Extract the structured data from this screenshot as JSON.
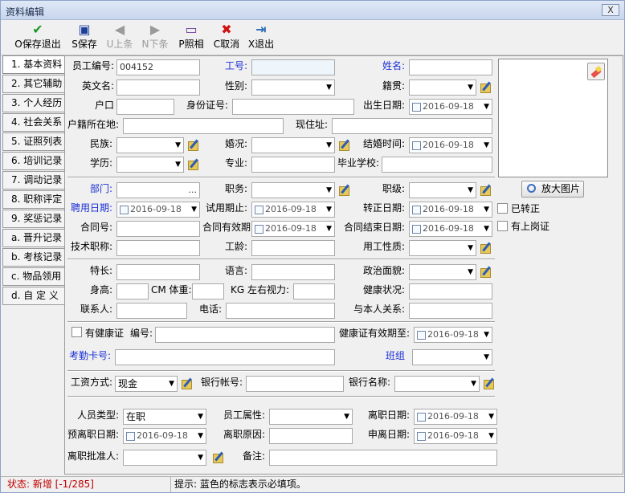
{
  "window": {
    "title": "资料编辑",
    "close_glyph": "X"
  },
  "toolbar": [
    {
      "key": "save_exit",
      "label": "O保存退出",
      "icon": "green-check-icon",
      "color": "#1a9a2a",
      "glyph": "✔",
      "enabled": true
    },
    {
      "key": "save",
      "label": "S保存",
      "icon": "floppy-disk-icon",
      "color": "#1c3f9a",
      "glyph": "▣",
      "enabled": true
    },
    {
      "key": "prev",
      "label": "U上条",
      "icon": "left-arrow-icon",
      "color": "#9a9a9a",
      "glyph": "◀",
      "enabled": false
    },
    {
      "key": "next",
      "label": "N下条",
      "icon": "right-arrow-icon",
      "color": "#9a9a9a",
      "glyph": "▶",
      "enabled": false
    },
    {
      "key": "photo",
      "label": "P照相",
      "icon": "camera-icon",
      "color": "#6a3a9a",
      "glyph": "▭",
      "enabled": true
    },
    {
      "key": "cancel",
      "label": "C取消",
      "icon": "red-x-icon",
      "color": "#d01010",
      "glyph": "✖",
      "enabled": true
    },
    {
      "key": "exit",
      "label": "X退出",
      "icon": "exit-door-icon",
      "color": "#2a6ab5",
      "glyph": "⇥",
      "enabled": true
    }
  ],
  "tabs": [
    "1. 基本资料",
    "2. 其它辅助",
    "3. 个人经历",
    "4. 社会关系",
    "5. 证照列表",
    "6. 培训记录",
    "7. 调动记录",
    "8. 职称评定",
    "9. 奖惩记录",
    "a. 晋升记录",
    "b. 考核记录",
    "c. 物品领用",
    "d. 自 定 义"
  ],
  "labels": {
    "emp_no": "员工编号:",
    "work_no": "工号:",
    "name": "姓名:",
    "eng_name": "英文名:",
    "gender": "性别:",
    "native": "籍贯:",
    "hukou": "户口",
    "id_no": "身份证号:",
    "birth": "出生日期:",
    "hukou_addr": "户籍所在地:",
    "address": "现住址:",
    "nation": "民族:",
    "marital": "婚况:",
    "marry_time": "结婚时间:",
    "edu": "学历:",
    "major": "专业:",
    "school": "毕业学校:",
    "dept": "部门:",
    "duty": "职务:",
    "rank": "职级:",
    "hire_date": "聘用日期:",
    "probation": "试用期止:",
    "regular_date": "转正日期:",
    "contract_no": "合同号:",
    "contract_valid": "合同有效期:",
    "contract_end": "合同结束日期:",
    "title": "技术职称:",
    "seniority": "工龄:",
    "emp_nature": "用工性质:",
    "specialty": "特长:",
    "language": "语言:",
    "political": "政治面貌:",
    "height": "身高:",
    "cm_weight": "CM 体重:",
    "kg_vision": "KG  左右视力:",
    "health": "健康状况:",
    "contact": "联系人:",
    "phone": "电话:",
    "relation": "与本人关系:",
    "health_cert": "有健康证",
    "health_no": "编号:",
    "health_valid": "健康证有效期至:",
    "card_no": "考勤卡号:",
    "shift": "班组",
    "wage_mode": "工资方式:",
    "bank_acct": "银行帐号:",
    "bank_name": "银行名称:",
    "emp_type": "人员类型:",
    "emp_attr": "员工属性:",
    "leave_date": "离职日期:",
    "pre_leave": "预离职日期:",
    "leave_reason": "离职原因:",
    "apply_leave": "申离日期:",
    "approver": "离职批准人:",
    "remark": "备注:",
    "regularized": "已转正",
    "has_post_cert": "有上岗证"
  },
  "values": {
    "emp_no": "004152",
    "dept_btn": "...",
    "date": "2016-09-18",
    "wage_mode": "现金",
    "emp_type": "在职"
  },
  "photo": {
    "zoom_label": "放大图片"
  },
  "status": {
    "state": "状态: 新增 [-1/285]",
    "hint": "提示: 蓝色的标志表示必填项。"
  },
  "colors": {
    "required_label": "#1b2fd6",
    "status_text": "#c00000"
  }
}
